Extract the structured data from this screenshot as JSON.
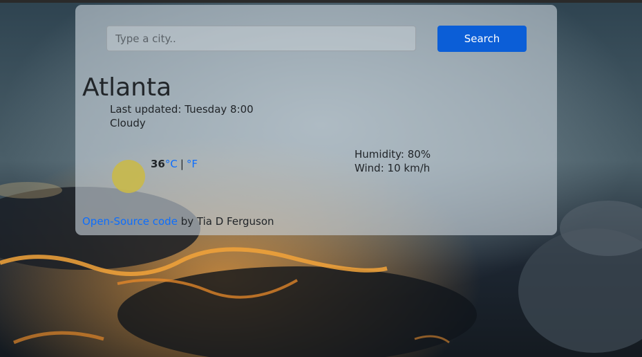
{
  "search": {
    "placeholder": "Type a city..",
    "value": "",
    "button_label": "Search"
  },
  "weather": {
    "city": "Atlanta",
    "last_updated_label": "Last updated:",
    "last_updated_value": "Tuesday 8:00",
    "description": "Cloudy",
    "icon": "sun-icon",
    "temperature": "36",
    "unit_celsius": "°C",
    "unit_separator": "|",
    "unit_fahrenheit": "°F",
    "humidity_label": "Humidity:",
    "humidity_value": "80%",
    "wind_label": "Wind:",
    "wind_value": "10 km/h"
  },
  "footer": {
    "link_text": "Open-Source code",
    "suffix": "by Tia D Ferguson"
  },
  "colors": {
    "accent": "#0b5ed7",
    "link": "#0d6efd",
    "card": "rgba(200, 210, 218, 0.62)"
  }
}
